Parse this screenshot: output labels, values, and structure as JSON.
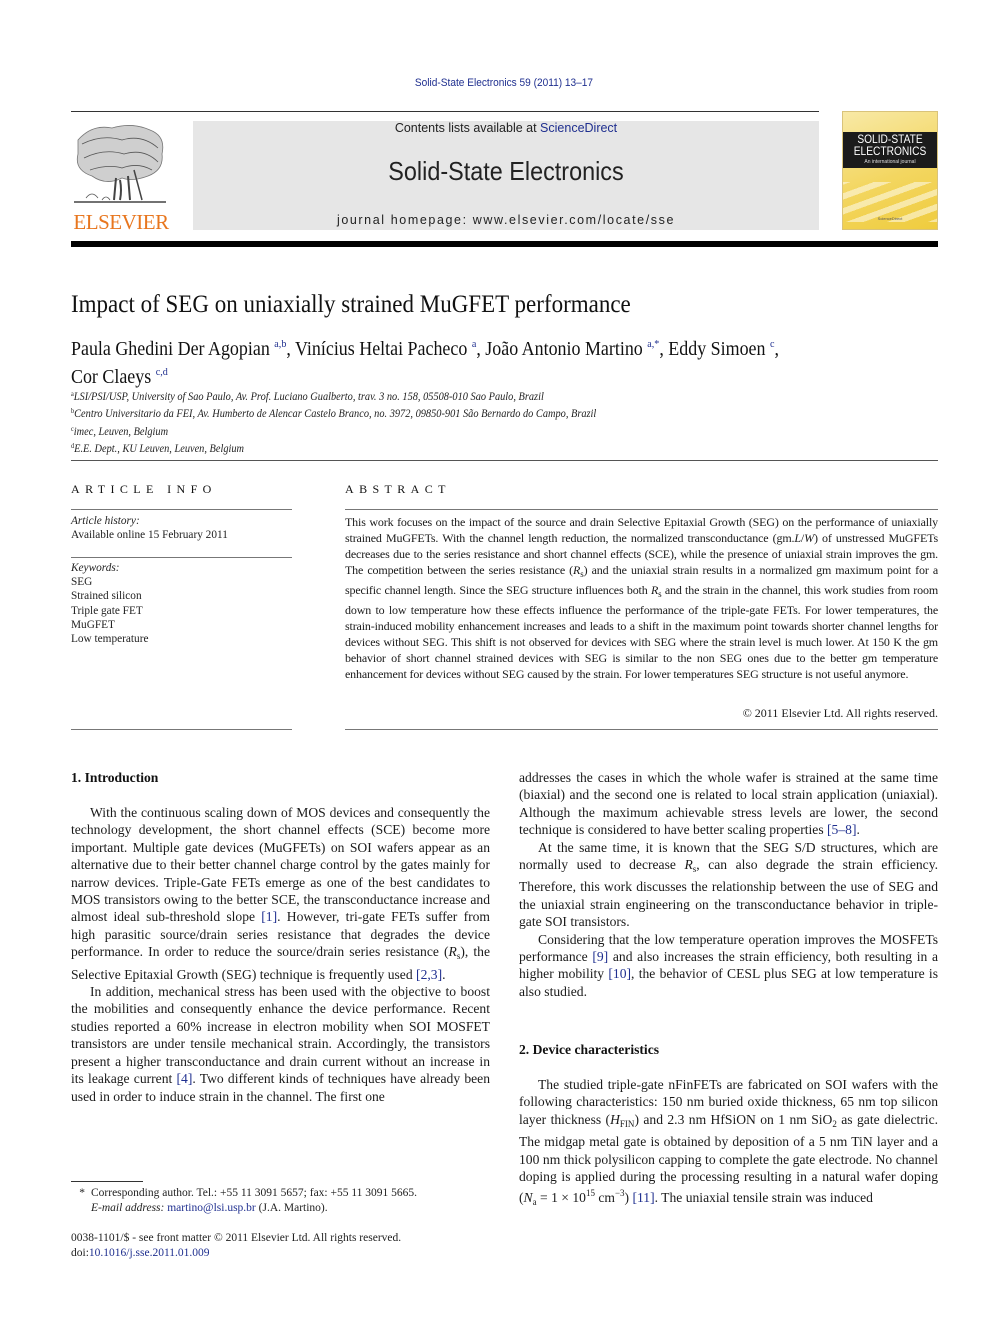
{
  "header": {
    "citation": "Solid-State Electronics 59 (2011) 13–17",
    "contents_prefix": "Contents lists available at ",
    "contents_link": "ScienceDirect",
    "journal_name": "Solid-State Electronics",
    "homepage": "journal homepage: www.elsevier.com/locate/sse",
    "publisher_logo_text": "ELSEVIER",
    "cover": {
      "title_line1": "SOLID-STATE",
      "title_line2": "ELECTRONICS",
      "subtitle": "An international journal",
      "publisher": "ScienceDirect"
    },
    "colors": {
      "link": "#1f2f8f",
      "elsevier_orange": "#e8761e",
      "banner_bg": "#e6e6e6",
      "cover_yellow": "#f3d660"
    }
  },
  "article": {
    "title": "Impact of SEG on uniaxially strained MuGFET performance",
    "authors": [
      {
        "name": "Paula Ghedini Der Agopian",
        "affil": "a,b",
        "sep": ", "
      },
      {
        "name": "Vinícius Heltai Pacheco",
        "affil": "a",
        "sep": ", "
      },
      {
        "name": "João Antonio Martino",
        "affil": "a,*",
        "sep": ", "
      },
      {
        "name": "Eddy Simoen",
        "affil": "c",
        "sep": ","
      },
      {
        "name": "Cor Claeys",
        "affil": "c,d",
        "sep": ""
      }
    ],
    "affiliations": [
      {
        "key": "a",
        "text": "LSI/PSI/USP, University of Sao Paulo, Av. Prof. Luciano Gualberto, trav. 3 no. 158, 05508-010 Sao Paulo, Brazil"
      },
      {
        "key": "b",
        "text": "Centro Universitario da FEI, Av. Humberto de Alencar Castelo Branco, no. 3972, 09850-901 São Bernardo do Campo, Brazil"
      },
      {
        "key": "c",
        "text": "imec, Leuven, Belgium"
      },
      {
        "key": "d",
        "text": "E.E. Dept., KU Leuven, Leuven, Belgium"
      }
    ]
  },
  "article_info": {
    "heading": "ARTICLE INFO",
    "history_label": "Article history:",
    "history_value": "Available online 15 February 2011",
    "keywords_label": "Keywords:",
    "keywords": [
      "SEG",
      "Strained silicon",
      "Triple gate FET",
      "MuGFET",
      "Low temperature"
    ]
  },
  "abstract": {
    "heading": "ABSTRACT",
    "parts": [
      "This work focuses on the impact of the source and drain Selective Epitaxial Growth (SEG) on the performance of uniaxially strained MuGFETs. With the channel length reduction, the normalized transconductance (gm.",
      "L",
      "/",
      "W",
      ") of unstressed MuGFETs decreases due to the series resistance and short channel effects (SCE), while the presence of uniaxial strain improves the gm. The competition between the series resistance (",
      "R",
      "s",
      ") and the uniaxial strain results in a normalized gm maximum point for a specific channel length. Since the SEG structure influences both ",
      "R",
      "s",
      " and the strain in the channel, this work studies from room down to low temperature how these effects influence the performance of the triple-gate FETs. For lower temperatures, the strain-induced mobility enhancement increases and leads to a shift in the maximum point towards shorter channel lengths for devices without SEG. This shift is not observed for devices with SEG where the strain level is much lower. At 150 K the gm behavior of short channel strained devices with SEG is similar to the non SEG ones due to the better gm temperature enhancement for devices without SEG caused by the strain. For lower temperatures SEG structure is not useful anymore."
    ],
    "copyright": "© 2011 Elsevier Ltd. All rights reserved."
  },
  "body": {
    "intro_heading": "1. Introduction",
    "intro_p1": {
      "a": "With the continuous scaling down of MOS devices and consequently the technology development, the short channel effects (SCE) become more important. Multiple gate devices (MuGFETs) on SOI wafers appear as an alternative due to their better channel charge control by the gates mainly for narrow devices. Triple-Gate FETs emerge as one of the best candidates to MOS transistors owing to the better SCE, the transconductance increase and almost ideal sub-threshold slope ",
      "ref1": "[1]",
      "b": ". However, tri-gate FETs suffer from high parasitic source/drain series resistance that degrades the device performance. In order to reduce the source/drain series resistance (",
      "rs_main": "R",
      "rs_sub": "s",
      "c": "), the Selective Epitaxial Growth (SEG) technique is frequently used ",
      "ref2": "[2,3]",
      "d": "."
    },
    "intro_p2": {
      "a": "In addition, mechanical stress has been used with the objective to boost the mobilities and consequently enhance the device performance. Recent studies reported a 60% increase in electron mobility when SOI MOSFET transistors are under tensile mechanical strain. Accordingly, the transistors present a higher transconductance and drain current without an increase in its leakage current ",
      "ref": "[4]",
      "b": ". Two different kinds of techniques have already been used in order to induce strain in the channel. The first one"
    },
    "col2_p1": {
      "a": "addresses the cases in which the whole wafer is strained at the same time (biaxial) and the second one is related to local strain application (uniaxial). Although the maximum achievable stress levels are lower, the second technique is considered to have better scaling properties ",
      "ref": "[5–8]",
      "b": "."
    },
    "col2_p2": {
      "a": "At the same time, it is known that the SEG S/D structures, which are normally used to decrease ",
      "rs_main": "R",
      "rs_sub": "s",
      "b": ", can also degrade the strain efficiency. Therefore, this work discusses the relationship between the use of SEG and the uniaxial strain engineering on the transconductance behavior in triple-gate SOI transistors."
    },
    "col2_p3": {
      "a": "Considering that the low temperature operation improves the MOSFETs performance ",
      "ref1": "[9]",
      "b": " and also increases the strain efficiency, both resulting in a higher mobility ",
      "ref2": "[10]",
      "c": ", the behavior of CESL plus SEG at low temperature is also studied."
    },
    "device_heading": "2. Device characteristics",
    "device_p1": {
      "a": "The studied triple-gate nFinFETs are fabricated on SOI wafers with the following characteristics: 150 nm buried oxide thickness, 65 nm top silicon layer thickness (",
      "h_main": "H",
      "h_sub": "FIN",
      "b": ") and 2.3 nm HfSiON on 1 nm SiO",
      "sio2_sub": "2",
      "c": " as gate dielectric. The midgap metal gate is obtained by deposition of a 5 nm TiN layer and a 100 nm thick polysilicon capping to complete the gate electrode. No channel doping is applied during the processing resulting in a natural wafer doping (",
      "na_main": "N",
      "na_sub": "a",
      "d": " = 1 × 10",
      "exp": "15",
      "e": " cm",
      "exp2": "−3",
      "f": ") ",
      "ref": "[11]",
      "g": ". The uniaxial tensile strain was induced"
    }
  },
  "footer": {
    "star": "*",
    "corresponding": "Corresponding author. Tel.: +55 11 3091 5657; fax: +55 11 3091 5665.",
    "email_label": "E-mail address:",
    "email": "martino@lsi.usp.br",
    "email_suffix": " (J.A. Martino).",
    "issn": "0038-1101/$ - see front matter © 2011 Elsevier Ltd. All rights reserved.",
    "doi_prefix": "doi:",
    "doi": "10.1016/j.sse.2011.01.009"
  }
}
